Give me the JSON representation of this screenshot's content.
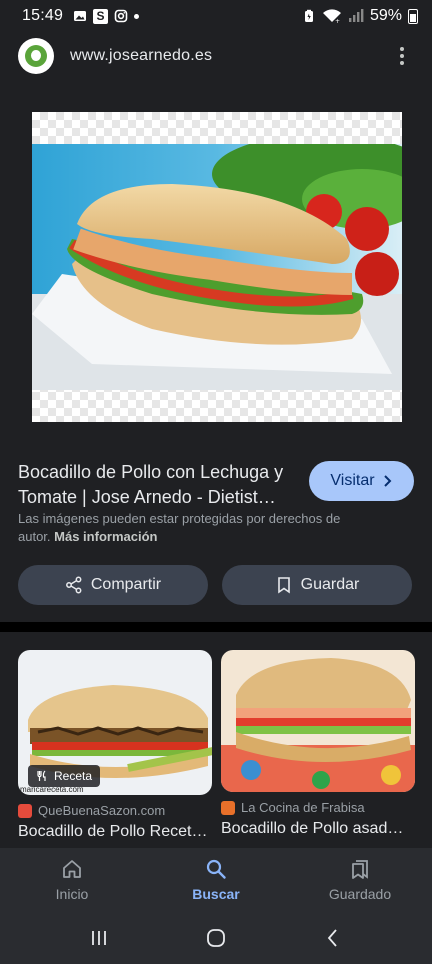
{
  "status_bar": {
    "time": "15:49",
    "battery": "59%",
    "s_icon": "S"
  },
  "header": {
    "url": "www.josearnedo.es"
  },
  "result": {
    "title": "Bocadillo de Pollo con Lechuga y Tomate | Jose Arnedo - Dietist…",
    "visit_label": "Visitar",
    "notice_text": "Las imágenes pueden estar protegidas por derechos de autor.",
    "notice_link": "Más información",
    "share_label": "Compartir",
    "save_label": "Guardar"
  },
  "related": [
    {
      "badge": "Receta",
      "source": "QueBuenaSazon.com",
      "title": "Bocadillo de Pollo Recet…",
      "watermark": "maricareceta.com"
    },
    {
      "source": "La Cocina de Frabisa",
      "title": "Bocadillo de Pollo asado…"
    }
  ],
  "bottom_nav": [
    {
      "label": "Inicio",
      "icon": "home-icon"
    },
    {
      "label": "Buscar",
      "icon": "search-icon",
      "active": true
    },
    {
      "label": "Guardado",
      "icon": "saved-icon"
    }
  ],
  "colors": {
    "accent": "#8ab4f8",
    "visit_button": "#a8c7fa",
    "panel": "#1f2023",
    "pill": "#3c4350"
  }
}
